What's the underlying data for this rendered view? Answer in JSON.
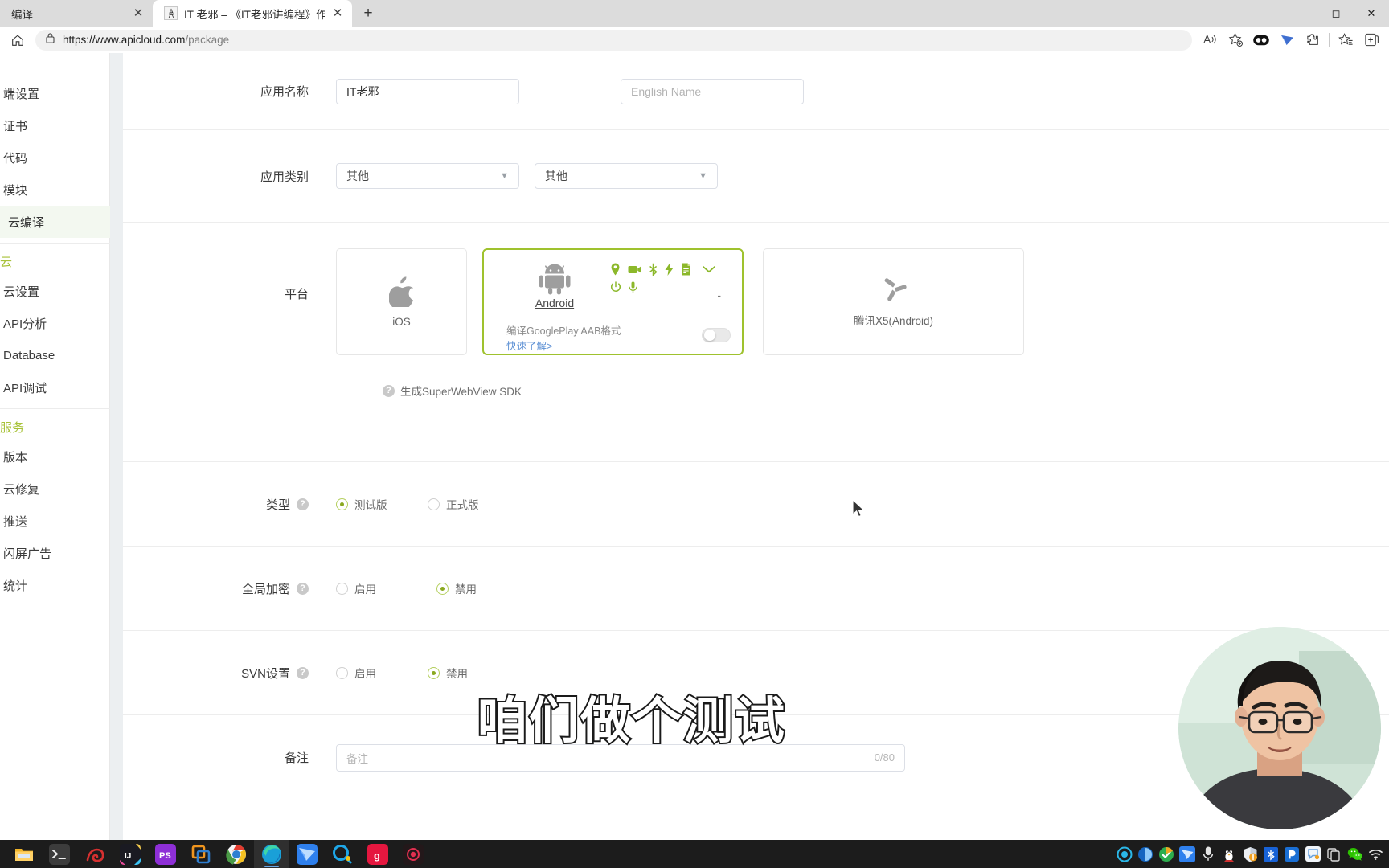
{
  "browser": {
    "tabs": [
      {
        "title": "编译",
        "favicon": "",
        "active": false,
        "close_icon": "close-icon"
      },
      {
        "title": "IT 老邪 – 《IT老邪讲编程》作者、",
        "favicon": "site-favicon",
        "active": true,
        "close_icon": "close-icon"
      }
    ],
    "new_tab_label": "+",
    "window_controls": [
      "minimize",
      "maximize",
      "close"
    ],
    "nav": {
      "home_icon": "home-icon",
      "lock_icon": "lock-icon",
      "url_scheme": "https://www.",
      "url_domain": "apicloud.com",
      "url_path": "/package",
      "url_full": "https://www.apicloud.com/package"
    },
    "toolbar_right_icons": [
      "read-aloud-icon",
      "add-favorite-icon",
      "extension-dark-reader-icon",
      "extension-foxmail-icon",
      "extensions-puzzle-icon",
      "favorites-icon",
      "collections-icon"
    ]
  },
  "sidebar": {
    "groups": [
      {
        "title": "",
        "items": [
          {
            "label": "端设置",
            "active": false
          },
          {
            "label": "证书",
            "active": false
          },
          {
            "label": "代码",
            "active": false
          },
          {
            "label": "模块",
            "active": false
          },
          {
            "label": "云编译",
            "active": true
          }
        ]
      },
      {
        "title": "云",
        "items": [
          {
            "label": "云设置",
            "active": false
          },
          {
            "label": "API分析",
            "active": false
          },
          {
            "label": "Database",
            "active": false
          },
          {
            "label": "API调试",
            "active": false
          }
        ]
      },
      {
        "title": "服务",
        "items": [
          {
            "label": "版本",
            "active": false
          },
          {
            "label": "云修复",
            "active": false
          },
          {
            "label": "推送",
            "active": false
          },
          {
            "label": "闪屏广告",
            "active": false
          },
          {
            "label": "统计",
            "active": false
          }
        ]
      }
    ]
  },
  "form": {
    "app_name": {
      "label": "应用名称",
      "value": "IT老邪",
      "english_placeholder": "English Name",
      "english_value": ""
    },
    "app_category": {
      "label": "应用类别",
      "primary_value": "其他",
      "secondary_value": "其他"
    },
    "platform": {
      "label": "平台",
      "cards": [
        {
          "name": "iOS",
          "icon": "apple-icon",
          "selected": false
        },
        {
          "name": "Android",
          "icon": "android-icon",
          "selected": true,
          "subtitle": "编译GooglePlay AAB格式",
          "link": "快速了解>",
          "dash": "-",
          "features": [
            "location-icon",
            "video-camera-icon",
            "bluetooth-icon",
            "flash-icon",
            "file-icon",
            "chevron-down-icon",
            "power-icon",
            "microphone-icon"
          ]
        },
        {
          "name": "腾讯X5(Android)",
          "icon": "tencent-x5-icon",
          "selected": false
        }
      ],
      "sdk_note": "生成SuperWebView SDK",
      "sdk_note_icon": "help-icon"
    },
    "type": {
      "label": "类型",
      "help_icon": "help-icon",
      "options": [
        {
          "label": "测试版",
          "selected": true
        },
        {
          "label": "正式版",
          "selected": false
        }
      ]
    },
    "global_encrypt": {
      "label": "全局加密",
      "help_icon": "help-icon",
      "options": [
        {
          "label": "启用",
          "selected": false
        },
        {
          "label": "禁用",
          "selected": true
        }
      ]
    },
    "svn_settings": {
      "label": "SVN设置",
      "help_icon": "help-icon",
      "options": [
        {
          "label": "启用",
          "selected": false
        },
        {
          "label": "禁用",
          "selected": true
        }
      ]
    },
    "remark": {
      "label": "备注",
      "placeholder": "备注",
      "value": "",
      "counter": "0/80"
    }
  },
  "overlay": {
    "subtitle": "咱们做个测试",
    "webcam_present": true,
    "cursor_icon": "mouse-pointer"
  },
  "taskbar": {
    "apps": [
      {
        "name": "file-explorer",
        "running": false
      },
      {
        "name": "terminal",
        "running": false
      },
      {
        "name": "snail-app",
        "running": false
      },
      {
        "name": "intellij-idea",
        "running": false
      },
      {
        "name": "photoshop",
        "running": false
      },
      {
        "name": "vmware",
        "running": false
      },
      {
        "name": "google-chrome",
        "running": false
      },
      {
        "name": "microsoft-edge",
        "running": true
      },
      {
        "name": "foxmail",
        "running": false
      },
      {
        "name": "qq-browser",
        "running": false
      },
      {
        "name": "youdao",
        "running": false
      },
      {
        "name": "recorder",
        "running": false
      }
    ],
    "tray": [
      "screen-recorder-icon",
      "security-icon",
      "360-icon",
      "foxmail-icon",
      "microphone-icon",
      "qq-penguin-icon",
      "shield-warning-icon",
      "bluetooth-icon",
      "dingtalk-icon",
      "chat-icon",
      "copy-icon",
      "wechat-icon",
      "wifi-icon"
    ]
  },
  "colors": {
    "accent_green": "#8cb82b",
    "selected_border": "#9fc22e",
    "sidebar_group": "#a8c23a",
    "link_blue": "#5b8fd4",
    "taskbar_bg": "#1c1c1c"
  }
}
